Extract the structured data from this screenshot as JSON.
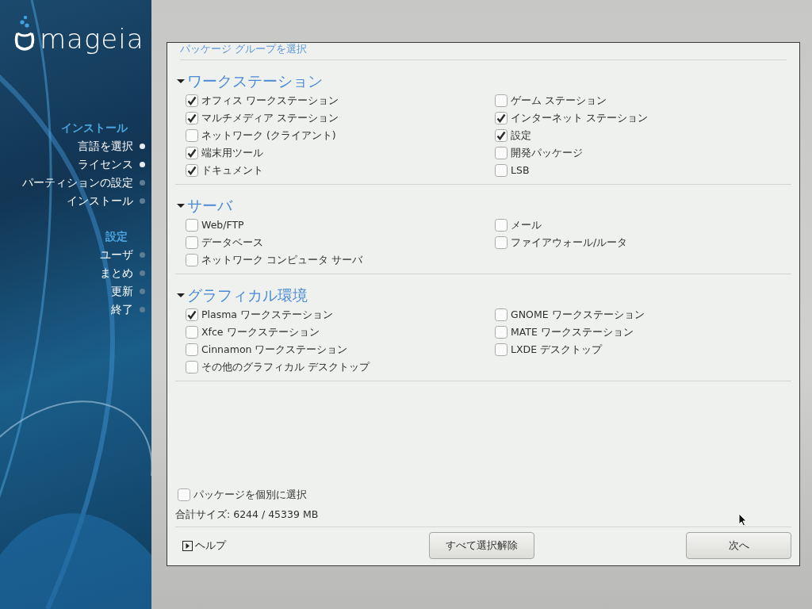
{
  "sidebar": {
    "logo": "mageia",
    "groups": [
      {
        "heading": "インストール",
        "steps": [
          {
            "label": "言語を選択",
            "done": true
          },
          {
            "label": "ライセンス",
            "done": true
          },
          {
            "label": "パーティションの設定",
            "done": false
          },
          {
            "label": "インストール",
            "done": false
          }
        ]
      },
      {
        "heading": "設定",
        "steps": [
          {
            "label": "ユーザ",
            "done": false
          },
          {
            "label": "まとめ",
            "done": false
          },
          {
            "label": "更新",
            "done": false
          },
          {
            "label": "終了",
            "done": false
          }
        ]
      }
    ]
  },
  "panel": {
    "title": "パッケージ グループを選択",
    "sections": [
      {
        "title": "ワークステーション",
        "expanded": true,
        "items": [
          {
            "label": "オフィス ワークステーション",
            "checked": true
          },
          {
            "label": "ゲーム ステーション",
            "checked": false
          },
          {
            "label": "マルチメディア ステーション",
            "checked": true
          },
          {
            "label": "インターネット ステーション",
            "checked": true
          },
          {
            "label": "ネットワーク (クライアント)",
            "checked": false
          },
          {
            "label": "設定",
            "checked": true
          },
          {
            "label": "端末用ツール",
            "checked": true
          },
          {
            "label": "開発パッケージ",
            "checked": false
          },
          {
            "label": "ドキュメント",
            "checked": true
          },
          {
            "label": "LSB",
            "checked": false
          }
        ]
      },
      {
        "title": "サーバ",
        "expanded": true,
        "items": [
          {
            "label": "Web/FTP",
            "checked": false
          },
          {
            "label": "メール",
            "checked": false
          },
          {
            "label": "データベース",
            "checked": false
          },
          {
            "label": "ファイアウォール/ルータ",
            "checked": false
          },
          {
            "label": "ネットワーク コンピュータ サーバ",
            "checked": false
          }
        ]
      },
      {
        "title": "グラフィカル環境",
        "expanded": true,
        "items": [
          {
            "label": "Plasma ワークステーション",
            "checked": true
          },
          {
            "label": "GNOME ワークステーション",
            "checked": false
          },
          {
            "label": "Xfce ワークステーション",
            "checked": false
          },
          {
            "label": "MATE ワークステーション",
            "checked": false
          },
          {
            "label": "Cinnamon ワークステーション",
            "checked": false
          },
          {
            "label": "LXDE デスクトップ",
            "checked": false
          },
          {
            "label": "その他のグラフィカル デスクトップ",
            "checked": false
          }
        ]
      }
    ],
    "individual": {
      "label": "パッケージを個別に選択",
      "checked": false
    },
    "total_size": "合計サイズ: 6244 / 45339 MB",
    "help": "ヘルプ",
    "buttons": [
      "すべて選択解除",
      "次へ"
    ]
  }
}
